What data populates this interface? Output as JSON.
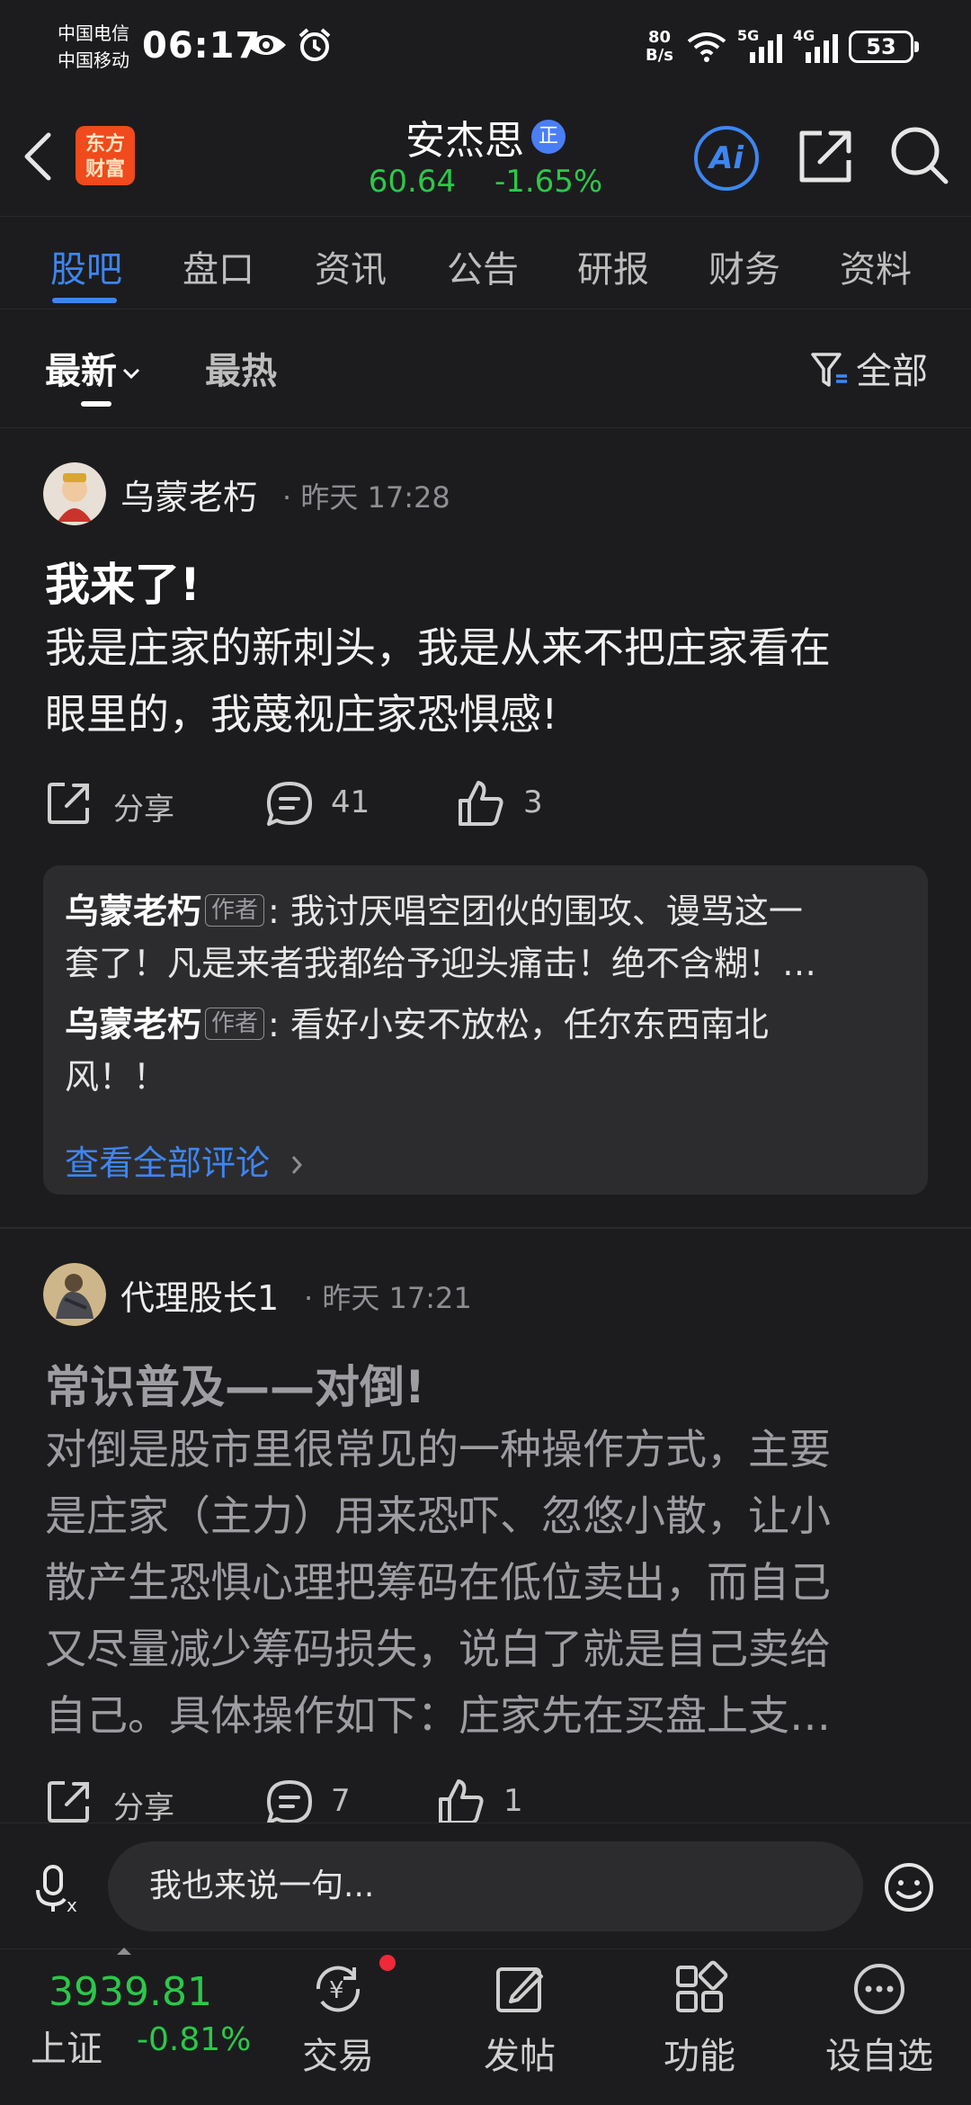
{
  "status_bar": {
    "carrier_1": "中国电信",
    "carrier_2": "中国移动",
    "time": "06:17",
    "net_speed_value": "80",
    "net_speed_unit": "B/s",
    "signal_1": "5G",
    "signal_2": "4G",
    "battery": "53"
  },
  "header": {
    "logo_line1": "东方",
    "logo_line2": "财富",
    "stock_name": "安杰思",
    "badge": "正",
    "price": "60.64",
    "change": "-1.65%",
    "ai_label": "Ai"
  },
  "tabs": [
    {
      "label": "股吧",
      "active": true
    },
    {
      "label": "盘口"
    },
    {
      "label": "资讯"
    },
    {
      "label": "公告"
    },
    {
      "label": "研报"
    },
    {
      "label": "财务"
    },
    {
      "label": "资料"
    }
  ],
  "filter": {
    "latest": "最新",
    "hot": "最热",
    "all": "全部"
  },
  "posts": [
    {
      "author": "乌蒙老朽",
      "time": "昨天 17:28",
      "title": "我来了!",
      "body_line1": "我是庄家的新刺头，我是从来不把庄家看在",
      "body_line2": "眼里的，我蔑视庄家恐惧感!",
      "share": "分享",
      "comments": "41",
      "likes": "3",
      "comment_list": [
        {
          "author": "乌蒙老朽",
          "tag": "作者",
          "text_line1": ": 我讨厌唱空团伙的围攻、谩骂这一",
          "text_line2": "套了！凡是来者我都给予迎头痛击！绝不含糊！…"
        },
        {
          "author": "乌蒙老朽",
          "tag": "作者",
          "text_line1": ": 看好小安不放松，任尔东西南北",
          "text_line2": "风！！"
        }
      ],
      "view_all": "查看全部评论"
    },
    {
      "author": "代理股长1",
      "time": "昨天 17:21",
      "title": "常识普及——对倒!",
      "body_lines": [
        "对倒是股市里很常见的一种操作方式，主要",
        "是庄家（主力）用来恐吓、忽悠小散，让小",
        "散产生恐惧心理把筹码在低位卖出，而自己",
        "又尽量减少筹码损失，说白了就是自己卖给",
        "自己。具体操作如下：庄家先在买盘上支…"
      ],
      "share": "分享",
      "comments": "7",
      "likes": "1"
    }
  ],
  "input": {
    "placeholder": "我也来说一句..."
  },
  "bottom_nav": {
    "index_value": "3939.81",
    "index_name": "上证",
    "index_change": "-0.81%",
    "items": [
      "交易",
      "发帖",
      "功能",
      "设自选"
    ]
  },
  "colors": {
    "background": "#1c1c1e",
    "accent_blue": "#3d86f2",
    "down_green": "#2bc84a",
    "logo_orange": "#f04a1d"
  }
}
